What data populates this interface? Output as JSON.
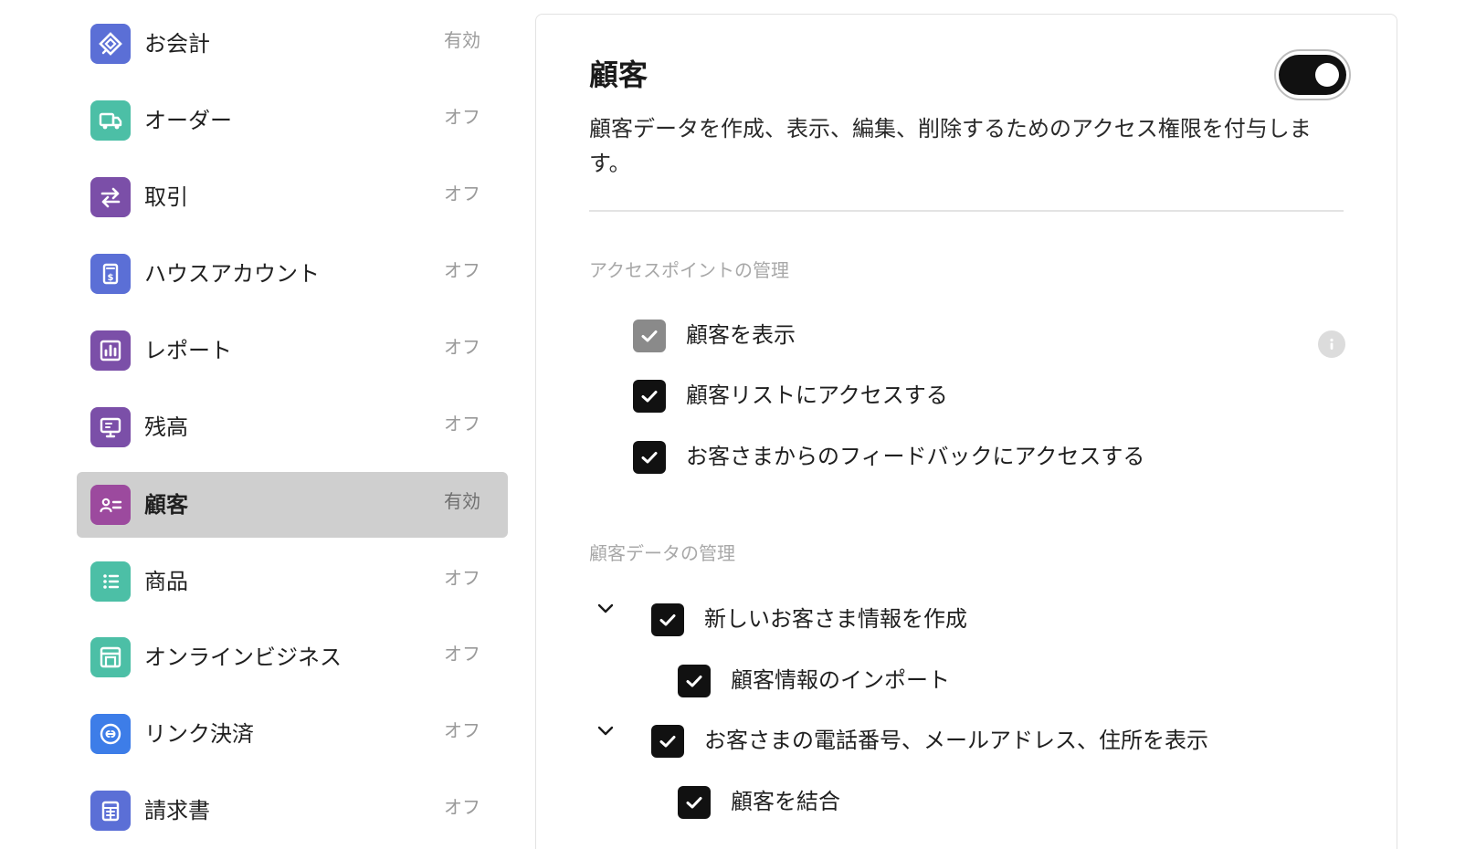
{
  "sidebar": {
    "items": [
      {
        "label": "お会計",
        "status": "有効",
        "icon": "pos-diamond-icon",
        "color": "#5b6fd6",
        "active": false
      },
      {
        "label": "オーダー",
        "status": "オフ",
        "icon": "truck-icon",
        "color": "#4cbfa6",
        "active": false
      },
      {
        "label": "取引",
        "status": "オフ",
        "icon": "transfer-arrows-icon",
        "color": "#7b4fa8",
        "active": false
      },
      {
        "label": "ハウスアカウント",
        "status": "オフ",
        "icon": "dollar-document-icon",
        "color": "#5b6fd6",
        "active": false
      },
      {
        "label": "レポート",
        "status": "オフ",
        "icon": "bar-chart-icon",
        "color": "#7b4fa8",
        "active": false
      },
      {
        "label": "残高",
        "status": "オフ",
        "icon": "monitor-icon",
        "color": "#7b4fa8",
        "active": false
      },
      {
        "label": "顧客",
        "status": "有効",
        "icon": "contact-card-icon",
        "color": "#9c4a9e",
        "active": true
      },
      {
        "label": "商品",
        "status": "オフ",
        "icon": "list-icon",
        "color": "#4cbfa6",
        "active": false
      },
      {
        "label": "オンラインビジネス",
        "status": "オフ",
        "icon": "storefront-icon",
        "color": "#4cbfa6",
        "active": false
      },
      {
        "label": "リンク決済",
        "status": "オフ",
        "icon": "link-circle-icon",
        "color": "#3d7de8",
        "active": false
      },
      {
        "label": "請求書",
        "status": "オフ",
        "icon": "invoice-icon",
        "color": "#5b6fd6",
        "active": false
      }
    ]
  },
  "panel": {
    "title": "顧客",
    "toggle_on": true,
    "description": "顧客データを作成、表示、編集、削除するためのアクセス権限を付与します。",
    "access_points": {
      "title": "アクセスポイントの管理",
      "items": [
        {
          "label": "顧客を表示",
          "checked": true,
          "disabled": true
        },
        {
          "label": "顧客リストにアクセスする",
          "checked": true,
          "disabled": false
        },
        {
          "label": "お客さまからのフィードバックにアクセスする",
          "checked": true,
          "disabled": false
        }
      ]
    },
    "data_management": {
      "title": "顧客データの管理",
      "items": [
        {
          "label": "新しいお客さま情報を作成",
          "checked": true
        },
        {
          "label": "顧客情報のインポート",
          "checked": true
        },
        {
          "label": "お客さまの電話番号、メールアドレス、住所を表示",
          "checked": true
        },
        {
          "label": "顧客を結合",
          "checked": true
        }
      ]
    }
  }
}
